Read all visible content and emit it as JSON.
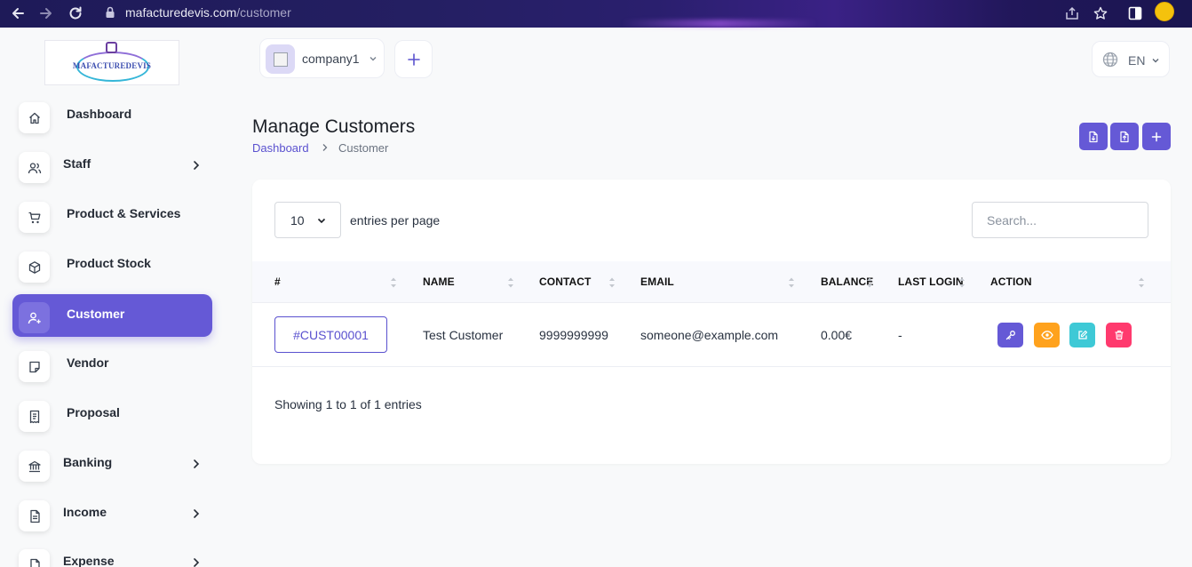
{
  "browser": {
    "url_domain": "mafacturedevis.com",
    "url_path": "/customer"
  },
  "brand": {
    "logo_text": "MAFACTUREDEVIS"
  },
  "sidebar": {
    "items": [
      {
        "label": "Dashboard",
        "icon": "home-icon",
        "expandable": false,
        "active": false
      },
      {
        "label": "Staff",
        "icon": "users-icon",
        "expandable": true,
        "active": false
      },
      {
        "label": "Product & Services",
        "icon": "cart-icon",
        "expandable": false,
        "active": false
      },
      {
        "label": "Product Stock",
        "icon": "box-icon",
        "expandable": false,
        "active": false
      },
      {
        "label": "Customer",
        "icon": "user-plus-icon",
        "expandable": false,
        "active": true
      },
      {
        "label": "Vendor",
        "icon": "note-icon",
        "expandable": false,
        "active": false
      },
      {
        "label": "Proposal",
        "icon": "receipt-icon",
        "expandable": false,
        "active": false
      },
      {
        "label": "Banking",
        "icon": "bank-icon",
        "expandable": true,
        "active": false
      },
      {
        "label": "Income",
        "icon": "file-invoice-icon",
        "expandable": true,
        "active": false
      },
      {
        "label": "Expense",
        "icon": "file-dollar-icon",
        "expandable": true,
        "active": false
      }
    ]
  },
  "header": {
    "company_name": "company1",
    "language": "EN"
  },
  "page": {
    "title": "Manage Customers",
    "breadcrumb_root": "Dashboard",
    "breadcrumb_current": "Customer",
    "toolbar_icons": [
      "file-import-icon",
      "file-export-icon",
      "plus-icon"
    ]
  },
  "table": {
    "per_page": "10",
    "per_page_label": "entries per page",
    "search_placeholder": "Search...",
    "columns": [
      "#",
      "NAME",
      "CONTACT",
      "EMAIL",
      "BALANCE",
      "LAST LOGIN",
      "ACTION"
    ],
    "rows": [
      {
        "id": "#CUST00001",
        "name": "Test Customer",
        "contact": "9999999999",
        "email": "someone@example.com",
        "balance": "0.00€",
        "last_login": "-",
        "actions": [
          "key-icon",
          "eye-icon",
          "edit-icon",
          "trash-icon"
        ]
      }
    ],
    "footer": "Showing 1 to 1 of 1 entries"
  },
  "colors": {
    "primary": "#6559d6",
    "view": "#ffa21d",
    "edit": "#3ec9d6",
    "delete": "#ff3a6e"
  }
}
